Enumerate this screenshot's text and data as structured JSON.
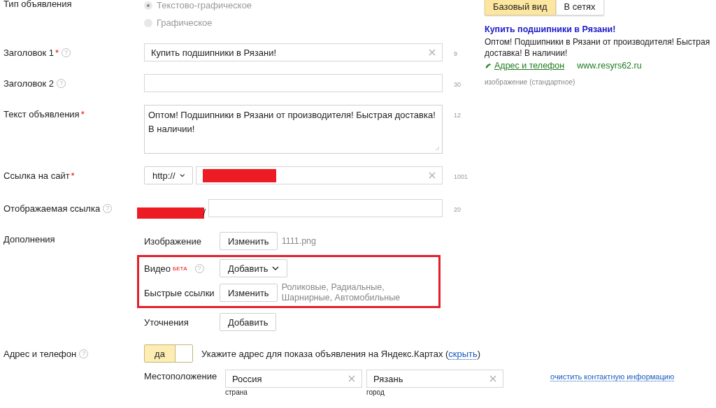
{
  "ad_type": {
    "label": "Тип объявления",
    "options": [
      {
        "label": "Текстово-графическое",
        "selected": true
      },
      {
        "label": "Графическое",
        "selected": false
      }
    ]
  },
  "fields": [
    {
      "kind": "input",
      "label": "Заголовок 1",
      "required_mark": "*",
      "help": "?",
      "value": "Купить подшипники в Рязани!",
      "clearable": true,
      "counter": "9"
    },
    {
      "kind": "input",
      "label": "Заголовок 2",
      "help": "?",
      "clearable": false,
      "counter": "30"
    },
    {
      "kind": "textarea",
      "label": "Текст объявления",
      "required_mark": "*",
      "value": "Оптом! Подшипники в Рязани от производителя! Быстрая доставка! В наличии!",
      "counter": "12"
    },
    {
      "kind": "url",
      "label": "Ссылка на сайт",
      "required_mark": "*",
      "protocol": "http://",
      "redacted": true,
      "clearable": true,
      "counter": "1001"
    },
    {
      "kind": "display",
      "label": "Отображаемая ссылка",
      "help": "?",
      "prefix": "/",
      "redacted": true,
      "counter": "20"
    }
  ],
  "supplements": {
    "label": "Дополнения",
    "items": [
      {
        "label": "Изображение",
        "button": "Изменить",
        "note": "1111.png",
        "highlighted": false
      },
      {
        "label": "Видео",
        "badge": "БЕТА",
        "help": "?",
        "button": "Добавить",
        "dropdown": true,
        "highlighted": true
      },
      {
        "label": "Быстрые ссылки",
        "button": "Изменить",
        "note": "Роликовые, Радиальные, Шарнирные, Автомобильные",
        "highlighted": true
      },
      {
        "label": "Уточнения",
        "button": "Добавить",
        "highlighted": false
      }
    ]
  },
  "address": {
    "label": "Адрес и телефон",
    "help": "?",
    "toggle": {
      "label": "да",
      "on": true
    },
    "hint": "Укажите адрес для показа объявления на Яндекс.Картах (",
    "hint_link": "скрыть",
    "hint_end": ")",
    "location_label": "Местоположение",
    "country": {
      "value": "Россия",
      "caption": "страна"
    },
    "city": {
      "value": "Рязань",
      "caption": "город"
    },
    "clear_link": "очистить контактную информацию"
  },
  "preview": {
    "tabs": [
      {
        "label": "Базовый вид",
        "selected": true
      },
      {
        "label": "В сетях",
        "selected": false
      }
    ],
    "title": "Купить подшипники в Рязани!",
    "text": "Оптом! Подшипники в Рязани от производителя! Быстрая доставка! В наличии!",
    "contact_link": "Адрес и телефон",
    "domain": "www.resyrs62.ru",
    "image_note": "изображение (стандартное)"
  }
}
